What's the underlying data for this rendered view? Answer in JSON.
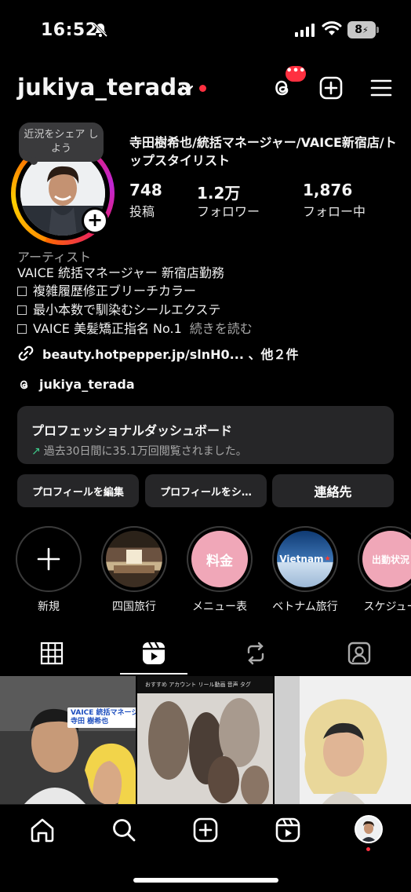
{
  "status": {
    "time": "16:52",
    "battery": "8"
  },
  "header": {
    "username": "jukiya_terada",
    "notif_badge": "•••"
  },
  "profile": {
    "bubble_text": "近況をシェア しよう",
    "full_name": "寺田樹希也/統括マネージャー/VAICE新宿店/トップスタイリスト",
    "stats": [
      {
        "value": "748",
        "label": "投稿"
      },
      {
        "value": "1.2万",
        "label": "フォロワー"
      },
      {
        "value": "1,876",
        "label": "フォロー中"
      }
    ],
    "category": "アーティスト",
    "bio_line1": "VAICE 統括マネージャー 新宿店勤務",
    "bio_items": [
      "複雑履歴修正ブリーチカラー",
      "最小本数で馴染むシールエクステ",
      "VAICE 美髪矯正指名 No.1"
    ],
    "read_more": "続きを読む",
    "link": "beauty.hotpepper.jp/slnH0... 、他２件",
    "threads_handle": "jukiya_terada"
  },
  "dashboard": {
    "title": "プロフェッショナルダッシュボード",
    "subtitle": "過去30日間に35.1万回閲覧されました。"
  },
  "buttons": {
    "edit_profile": "プロフィールを編集",
    "share_profile": "プロフィールをシ…",
    "contact": "連絡先"
  },
  "highlights": [
    {
      "label": "新規",
      "cover_text": ""
    },
    {
      "label": "四国旅行",
      "cover_text": ""
    },
    {
      "label": "メニュー表",
      "cover_text": "料金"
    },
    {
      "label": "ベトナム旅行",
      "cover_text": "Vietnam"
    },
    {
      "label": "スケジュー",
      "cover_text": "出勤状況"
    }
  ],
  "grid": {
    "thumb1_caption": "VAICE 統括マネージャー\n寺田 樹希也",
    "thumb2_tabs": "おすすめ  アカウント  リール動画  音声  タグ"
  },
  "colors": {
    "accent_red": "#ff3040",
    "pink_highlight": "#f0a7b8",
    "card_bg": "#262628"
  }
}
